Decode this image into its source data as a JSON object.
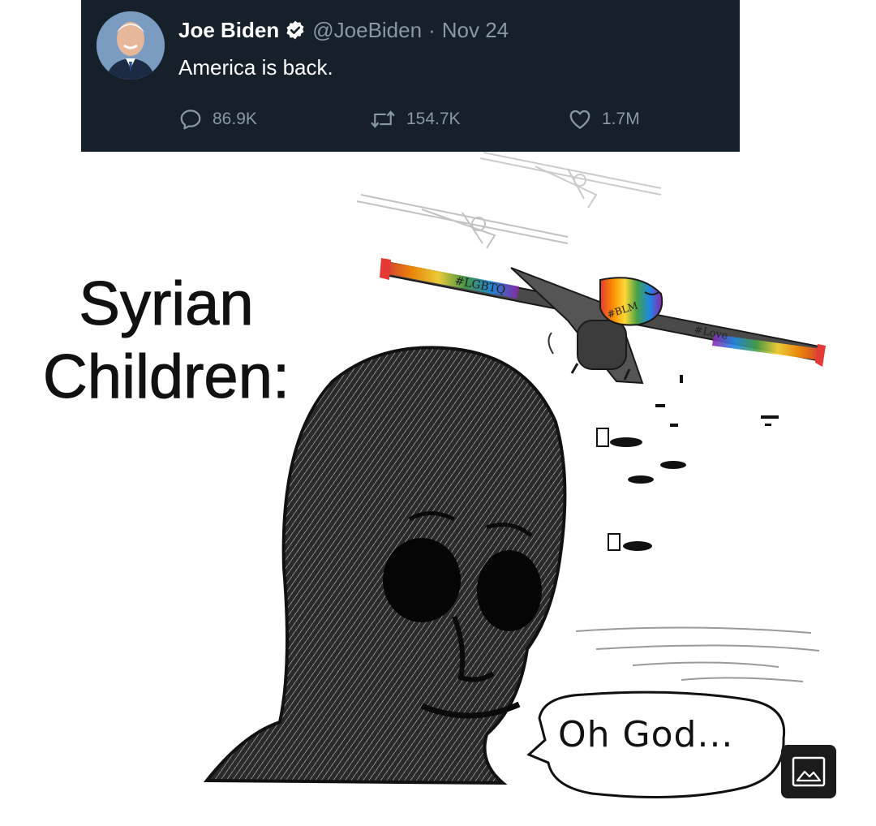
{
  "tweet": {
    "author_name": "Joe Biden",
    "handle": "@JoeBiden",
    "separator": "·",
    "date": "Nov 24",
    "text": "America is back.",
    "replies": "86.9K",
    "retweets": "154.7K",
    "likes": "1.7M"
  },
  "meme": {
    "caption_line1": "Syrian",
    "caption_line2": "Children:",
    "speech": "Oh God...",
    "drone_tags": [
      "#LGBTQ",
      "#BLM",
      "#Love"
    ]
  },
  "colors": {
    "tweet_background": "#15202b",
    "muted_text": "#8899a6",
    "verified_badge": "#ffffff",
    "rainbow": [
      "#e53935",
      "#fb8c00",
      "#fdd835",
      "#43a047",
      "#1e88e5",
      "#8e24aa"
    ]
  },
  "icons": {
    "reply": "speech-bubble-icon",
    "retweet": "retweet-arrows-icon",
    "like": "heart-icon",
    "verified": "verified-badge-icon",
    "image_badge": "image-icon"
  }
}
